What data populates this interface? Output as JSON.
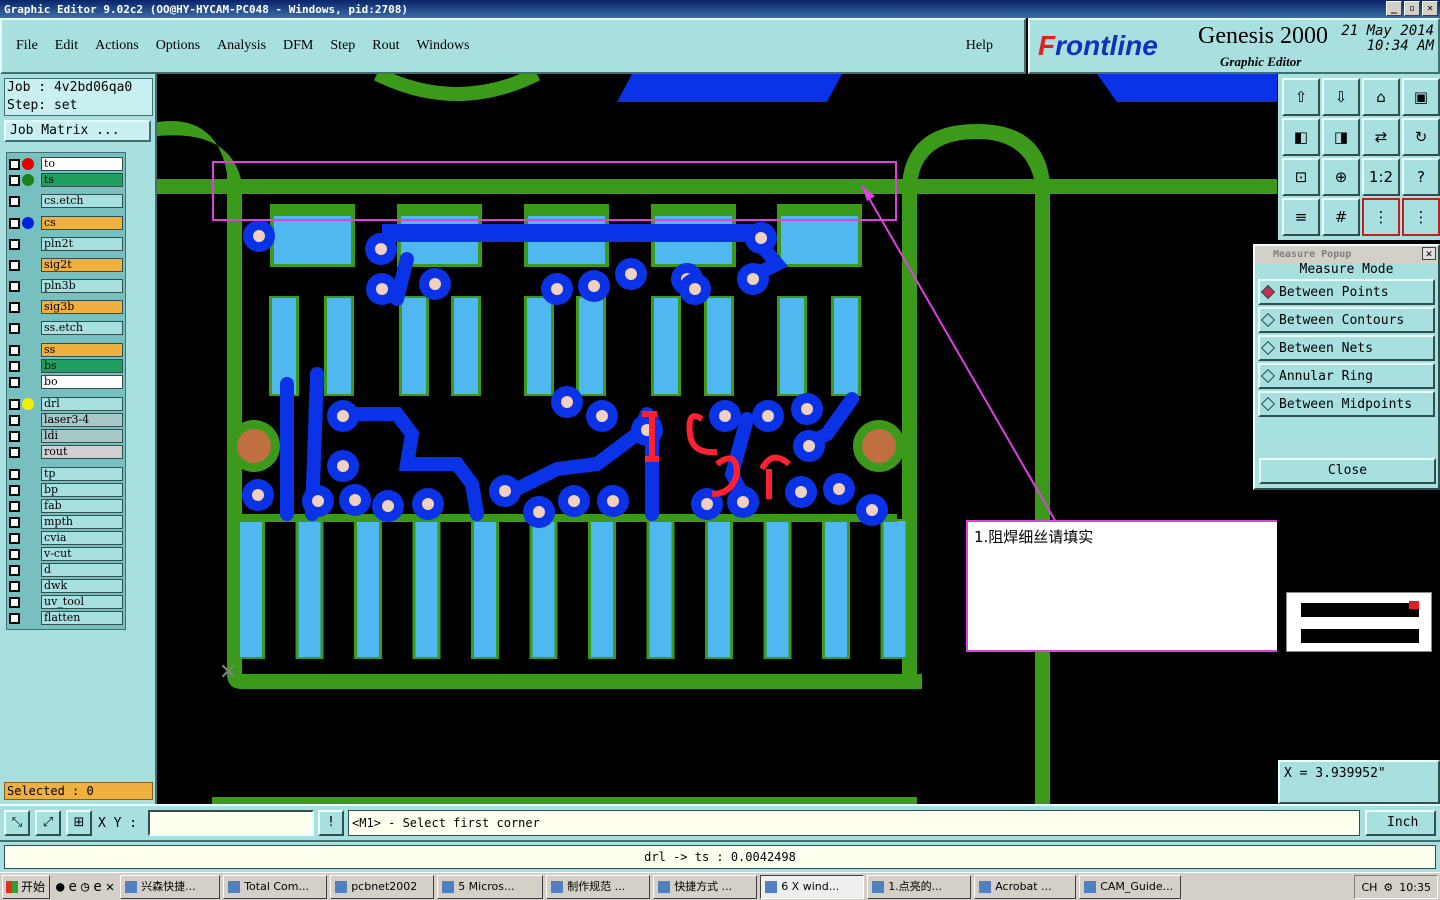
{
  "window": {
    "title": "Graphic Editor 9.02c2  (OO@HY-HYCAM-PC048 - Windows, pid:2708)"
  },
  "menu": {
    "items": [
      "File",
      "Edit",
      "Actions",
      "Options",
      "Analysis",
      "DFM",
      "Step",
      "Rout",
      "Windows"
    ],
    "help": "Help"
  },
  "brand": {
    "logo_prefix": "F",
    "logo": "rontline",
    "product": "Genesis 2000",
    "subtitle": "Graphic Editor",
    "date": "21 May 2014",
    "time": "10:34 AM"
  },
  "job": {
    "job_line": "Job : 4v2bd06qa0",
    "step_line": "Step: set",
    "matrix_button": "Job Matrix ..."
  },
  "layers": [
    {
      "name": "to",
      "color": "#ffffff",
      "dot": "#e00000"
    },
    {
      "name": "ts",
      "color": "#20a060",
      "dot": "#208020"
    },
    {
      "name": "cs.etch",
      "color": "#a8e0e0",
      "dot": ""
    },
    {
      "name": "cs",
      "color": "#f0b040",
      "dot": "#0020e0"
    },
    {
      "name": "pln2t",
      "color": "#a8e0e0",
      "dot": ""
    },
    {
      "name": "sig2t",
      "color": "#f0b040",
      "dot": ""
    },
    {
      "name": "pln3b",
      "color": "#a8e0e0",
      "dot": ""
    },
    {
      "name": "sig3b",
      "color": "#f0b040",
      "dot": ""
    },
    {
      "name": "ss.etch",
      "color": "#a8e0e0",
      "dot": ""
    },
    {
      "name": "ss",
      "color": "#f0b040",
      "dot": ""
    },
    {
      "name": "bs",
      "color": "#20a060",
      "dot": ""
    },
    {
      "name": "bo",
      "color": "#ffffff",
      "dot": ""
    },
    {
      "name": "drl",
      "color": "#a8e0e0",
      "dot": "#f0f000"
    },
    {
      "name": "laser3-4",
      "color": "#a8c8c8",
      "dot": ""
    },
    {
      "name": "ldi",
      "color": "#a8c8c8",
      "dot": ""
    },
    {
      "name": "rout",
      "color": "#d0d0d0",
      "dot": ""
    },
    {
      "name": "tp",
      "color": "#a8e0e0",
      "dot": ""
    },
    {
      "name": "bp",
      "color": "#a8e0e0",
      "dot": ""
    },
    {
      "name": "fab",
      "color": "#a8e0e0",
      "dot": ""
    },
    {
      "name": "mpth",
      "color": "#a8e0e0",
      "dot": ""
    },
    {
      "name": "cvia",
      "color": "#a8e0e0",
      "dot": ""
    },
    {
      "name": "v-cut",
      "color": "#a8e0e0",
      "dot": ""
    },
    {
      "name": "d",
      "color": "#a8e0e0",
      "dot": ""
    },
    {
      "name": "dwk",
      "color": "#a8e0e0",
      "dot": ""
    },
    {
      "name": "uv_tool",
      "color": "#a8e0e0",
      "dot": ""
    },
    {
      "name": "flatten",
      "color": "#a8e0e0",
      "dot": ""
    }
  ],
  "selected": "Selected : 0",
  "annotation": "1.阻焊细丝请填实",
  "measure": {
    "title": "Measure Popup",
    "mode_label": "Measure Mode",
    "options": [
      "Between Points",
      "Between Contours",
      "Between Nets",
      "Annular Ring",
      "Between Midpoints"
    ],
    "selected": "Between Points",
    "close": "Close"
  },
  "coord": "X = 3.939952\"",
  "cmd": {
    "xy_label": "X Y :",
    "xy_value": "",
    "prompt": "<M1> - Select first corner",
    "unit": "Inch"
  },
  "status": "drl -> ts : 0.0042498",
  "taskbar": {
    "start": "开始",
    "tasks": [
      "兴森快捷...",
      "Total Com...",
      "pcbnet2002",
      "5 Micros...",
      "制作规范 ...",
      "快捷方式 ...",
      "6 X wind...",
      "1.点亮的...",
      "Acrobat ...",
      "CAM_Guide..."
    ],
    "active": "6 X wind...",
    "tray_lang": "CH",
    "clock": "10:35"
  },
  "colors": {
    "panel": "#a8e0e0",
    "green": "#3c9a1a",
    "pad": "#4fb8f0",
    "trace": "#0a32e6",
    "magenta": "#e040e0"
  }
}
